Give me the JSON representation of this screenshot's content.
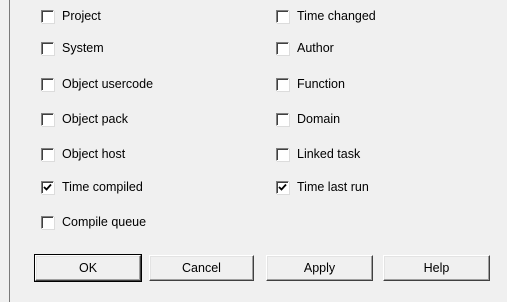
{
  "options": {
    "project": {
      "label": "Project",
      "checked": false
    },
    "system": {
      "label": "System",
      "checked": false
    },
    "object_usercode": {
      "label": "Object usercode",
      "checked": false
    },
    "object_pack": {
      "label": "Object pack",
      "checked": false
    },
    "object_host": {
      "label": "Object host",
      "checked": false
    },
    "time_compiled": {
      "label": "Time compiled",
      "checked": true
    },
    "compile_queue": {
      "label": "Compile queue",
      "checked": false
    },
    "time_changed": {
      "label": "Time changed",
      "checked": false
    },
    "author": {
      "label": "Author",
      "checked": false
    },
    "function": {
      "label": "Function",
      "checked": false
    },
    "domain": {
      "label": "Domain",
      "checked": false
    },
    "linked_task": {
      "label": "Linked task",
      "checked": false
    },
    "time_last_run": {
      "label": "Time last run",
      "checked": true
    }
  },
  "buttons": {
    "ok": "OK",
    "cancel": "Cancel",
    "apply": "Apply",
    "help": "Help"
  }
}
